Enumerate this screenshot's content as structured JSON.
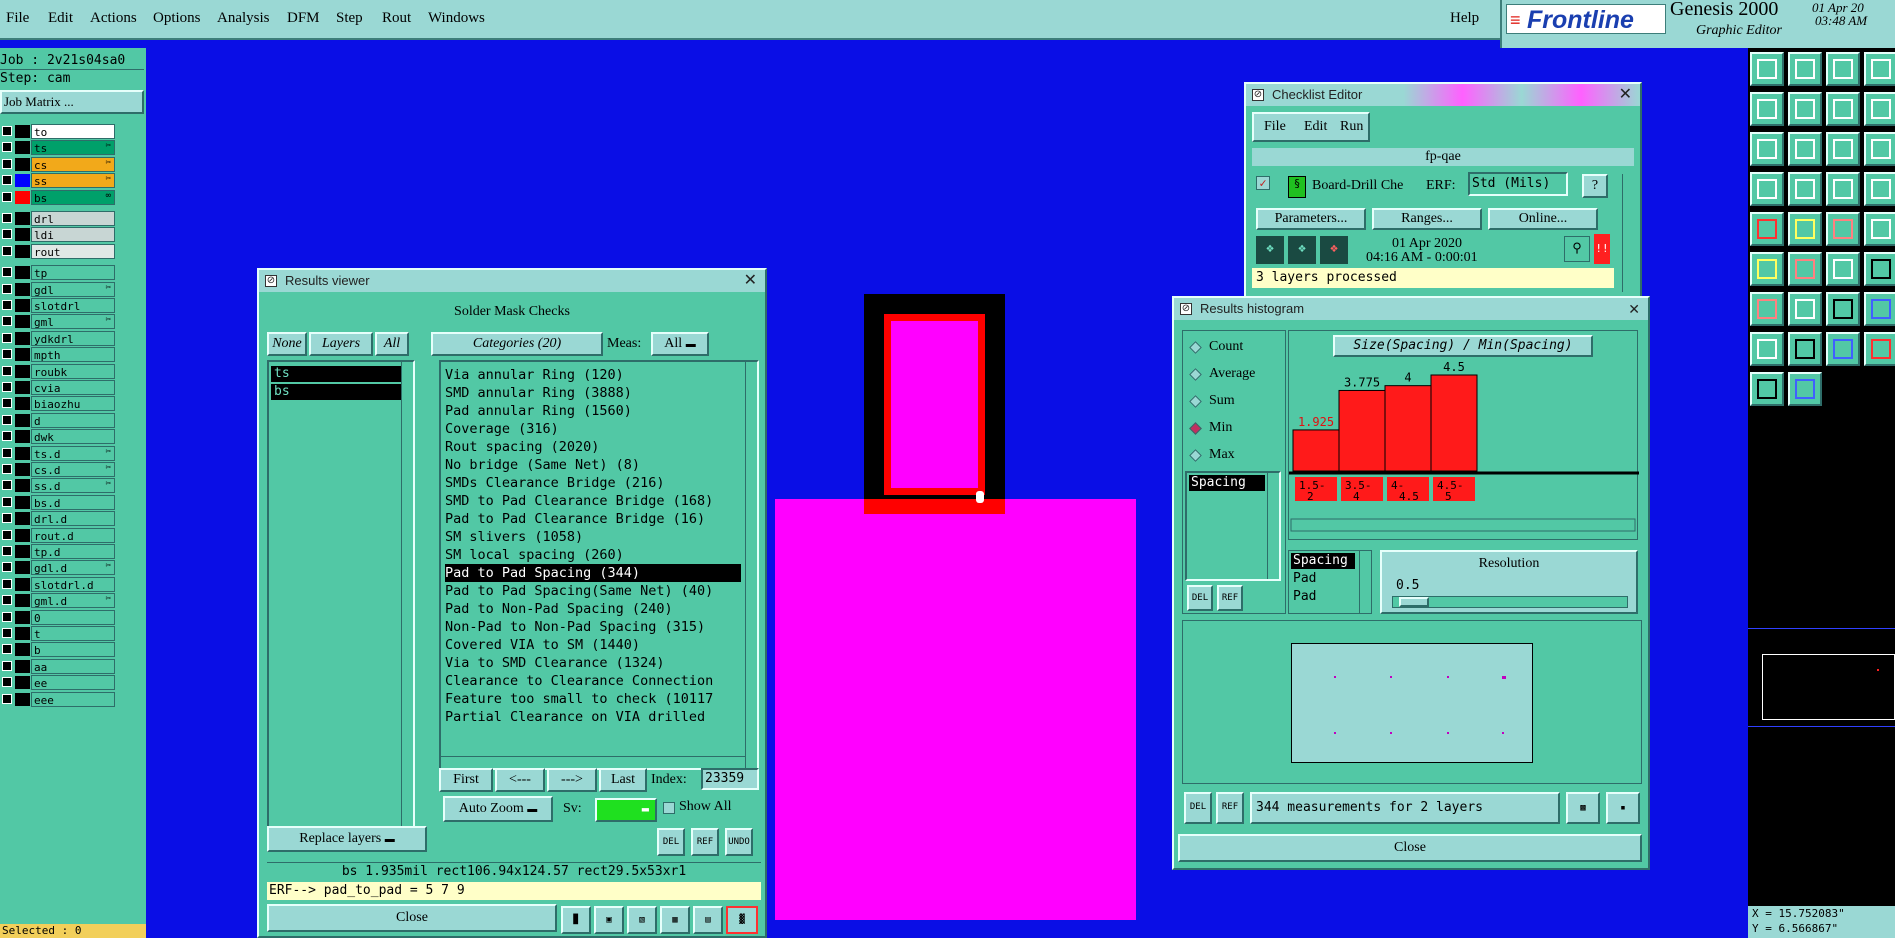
{
  "menubar": {
    "items": [
      "File",
      "Edit",
      "Actions",
      "Options",
      "Analysis",
      "DFM",
      "Step",
      "Rout",
      "Windows"
    ],
    "help": "Help"
  },
  "brand": {
    "logo": "Frontline",
    "product": "Genesis 2000",
    "subtitle": "Graphic Editor",
    "date": "01 Apr 20",
    "time": "03:48 AM"
  },
  "left": {
    "job": "Job : 2v21s04sa0",
    "step": "Step: cam",
    "job_matrix": "Job Matrix ...",
    "layers_board": [
      {
        "name": "to",
        "color": "#ffffff",
        "swatch": "#000000",
        "edit": ""
      },
      {
        "name": "ts",
        "color": "#00a06a",
        "swatch": "#000000",
        "edit": "✂"
      },
      {
        "name": "cs",
        "color": "#f2a91a",
        "swatch": "#000000",
        "edit": "✂"
      },
      {
        "name": "ss",
        "color": "#f2a91a",
        "swatch": "#0000ff",
        "edit": "✂"
      },
      {
        "name": "bs",
        "color": "#00a06a",
        "swatch": "#ff0000",
        "edit": "∞"
      }
    ],
    "layers_drill": [
      {
        "name": "drl",
        "color": "#c8d6d4"
      },
      {
        "name": "ldi",
        "color": "#c8d6d4"
      },
      {
        "name": "rout",
        "color": "#e0e8e6"
      }
    ],
    "layers_misc": [
      "tp",
      "gdl",
      "slotdrl",
      "gml",
      "ydkdrl",
      "mpth",
      "roubk",
      "cvia",
      "biaozhu",
      "d",
      "dwk",
      "ts.d",
      "cs.d",
      "ss.d",
      "bs.d",
      "drl.d",
      "rout.d",
      "tp.d",
      "gdl.d",
      "slotdrl.d",
      "gml.d",
      "0",
      "t",
      "b",
      "aa",
      "ee",
      "eee"
    ],
    "misc_edit": {
      "gdl": "✂",
      "gml": "✂",
      "ts.d": "✂",
      "cs.d": "✂",
      "ss.d": "✂",
      "gdl.d": "✂",
      "gml.d": "✂"
    },
    "selected": "Selected : 0"
  },
  "results_viewer": {
    "title": "Results viewer",
    "header": "Solder Mask Checks",
    "none": "None",
    "layers": "Layers",
    "all": "All",
    "categories_btn": "Categories (20)",
    "meas_label": "Meas:",
    "meas_value": "All",
    "layer_list": [
      "ts",
      "bs"
    ],
    "categories": [
      "Via annular Ring (120)",
      "SMD annular Ring (3888)",
      "Pad annular Ring (1560)",
      "Coverage (316)",
      "Rout spacing (2020)",
      "No bridge (Same Net) (8)",
      "SMDs Clearance Bridge (216)",
      "SMD to Pad Clearance Bridge (168)",
      "Pad to Pad Clearance Bridge (16)",
      "SM slivers (1058)",
      "SM local spacing (260)",
      "Pad to Pad Spacing (344)",
      "Pad to Pad Spacing(Same Net) (40)",
      "Pad to Non-Pad Spacing (240)",
      "Non-Pad to Non-Pad Spacing (315)",
      "Covered VIA to SM (1440)",
      "Via to SMD Clearance (1324)",
      "Clearance to Clearance Connection",
      "Feature too small to check (10117",
      "Partial Clearance on VIA drilled"
    ],
    "selected_category": "Pad to Pad Spacing (344)",
    "nav": {
      "first": "First",
      "prev": "<---",
      "next": "--->",
      "last": "Last",
      "index_label": "Index:",
      "index_value": "23359"
    },
    "auto_zoom": "Auto Zoom",
    "sv_label": "Sv:",
    "show_all": "Show All",
    "replace_layers": "Replace layers",
    "del": "DEL",
    "ref": "REF",
    "undo": "UNDO",
    "status": "bs 1.935mil  rect106.94x124.57  rect29.5x53xr1",
    "erf": "ERF--> pad_to_pad = 5 7 9",
    "close": "Close"
  },
  "checklist": {
    "title": "Checklist Editor",
    "menu": [
      "File",
      "Edit",
      "Run"
    ],
    "name": "fp-qae",
    "action": "Board-Drill Che",
    "erf_label": "ERF:",
    "erf_value": "Std (Mils)",
    "question": "?",
    "parameters": "Parameters...",
    "ranges": "Ranges...",
    "online": "Online...",
    "date": "01 Apr 2020",
    "time": "04:16 AM - 0:00:01",
    "processed": "3 layers processed",
    "warn": "!!"
  },
  "histogram": {
    "title": "Results histogram",
    "radio": [
      "Count",
      "Average",
      "Sum",
      "Min",
      "Max"
    ],
    "selected_radio": "Min",
    "measure_list": [
      "Spacing"
    ],
    "chart_title": "Size(Spacing) / Min(Spacing)",
    "values": [
      1.925,
      3.775,
      4,
      4.5
    ],
    "value_labels": [
      "1.925",
      "3.775",
      "4",
      "4.5"
    ],
    "value_max": 4.5,
    "bins": [
      "1.5-2",
      "3.5-4",
      "4-4.5",
      "4.5-5"
    ],
    "bin_lines": [
      [
        "1.5-",
        "2"
      ],
      [
        "3.5-",
        "4"
      ],
      [
        "4-",
        "4.5"
      ],
      [
        "4.5-",
        "5"
      ]
    ],
    "types": [
      "Spacing",
      "Pad",
      "Pad"
    ],
    "resolution_label": "Resolution",
    "resolution_value": "0.5",
    "del": "DEL",
    "ref": "REF",
    "count_text": "344 measurements for 2 layers",
    "close": "Close"
  },
  "coords": {
    "x": "X = 15.752083\"",
    "y": "Y = 6.566867\""
  },
  "colors": {
    "canvas": "#0a0ee6",
    "magenta": "#ff00ff",
    "red": "#ff0000",
    "panel": "#52c8a5",
    "frame": "#9ad8d4"
  }
}
